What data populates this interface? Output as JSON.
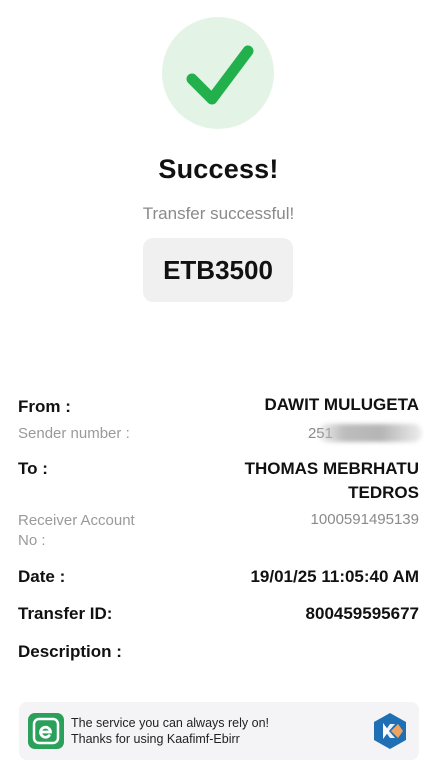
{
  "status": {
    "title": "Success!",
    "subtitle": "Transfer successful!",
    "amount": "ETB3500",
    "icon": "check-icon",
    "accent_color": "#21b04b"
  },
  "details": {
    "from_label": "From :",
    "from_value": "DAWIT MULUGETA",
    "sender_label": "Sender number :",
    "sender_value": "251",
    "to_label": "To :",
    "to_value_line1": "THOMAS MEBRHATU",
    "to_value_line2": "TEDROS",
    "receiver_label_line1": "Receiver Account",
    "receiver_label_line2": "No :",
    "receiver_value": "1000591495139",
    "date_label": "Date :",
    "date_value": "19/01/25 11:05:40 AM",
    "transfer_id_label": "Transfer ID:",
    "transfer_id_value": "800459595677",
    "description_label": "Description :",
    "description_value": ""
  },
  "footer": {
    "line1": "The service you can always rely on!",
    "line2": "Thanks for using Kaafimf-Ebirr",
    "left_logo_icon": "ebirr-logo-icon",
    "right_logo_icon": "kaafi-logo-icon"
  }
}
